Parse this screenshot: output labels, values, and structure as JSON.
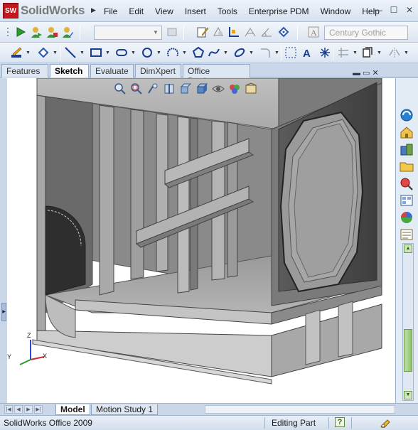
{
  "app": {
    "logo_mark": "SW",
    "logo_name": "SolidWorks",
    "window_controls": [
      "—",
      "☐",
      "✕"
    ]
  },
  "menu": [
    "File",
    "Edit",
    "View",
    "Insert",
    "Tools",
    "Enterprise PDM",
    "Window",
    "Help"
  ],
  "toolbar": {
    "font_placeholder": "Century Gothic"
  },
  "command_tabs": [
    {
      "label": "Features",
      "active": false
    },
    {
      "label": "Sketch",
      "active": true
    },
    {
      "label": "Evaluate",
      "active": false
    },
    {
      "label": "DimXpert",
      "active": false
    },
    {
      "label": "Office Products",
      "active": false
    }
  ],
  "bottom_tabs": [
    {
      "label": "Model",
      "active": true
    },
    {
      "label": "Motion Study 1",
      "active": false
    }
  ],
  "triad": {
    "x": "X",
    "y": "Y",
    "z": "Z"
  },
  "status": {
    "product": "SolidWorks Office 2009",
    "mode": "Editing Part",
    "help": "?"
  },
  "colors": {
    "accent": "#c4181f",
    "chrome": "#c9d7e8",
    "model_face_light": "#b8b8b8",
    "model_face_mid": "#8f8f8f",
    "model_face_dark": "#4d4d4d"
  },
  "icons": {
    "new": "green-triangle-play-icon",
    "rebuild": "traffic-light-icon"
  }
}
